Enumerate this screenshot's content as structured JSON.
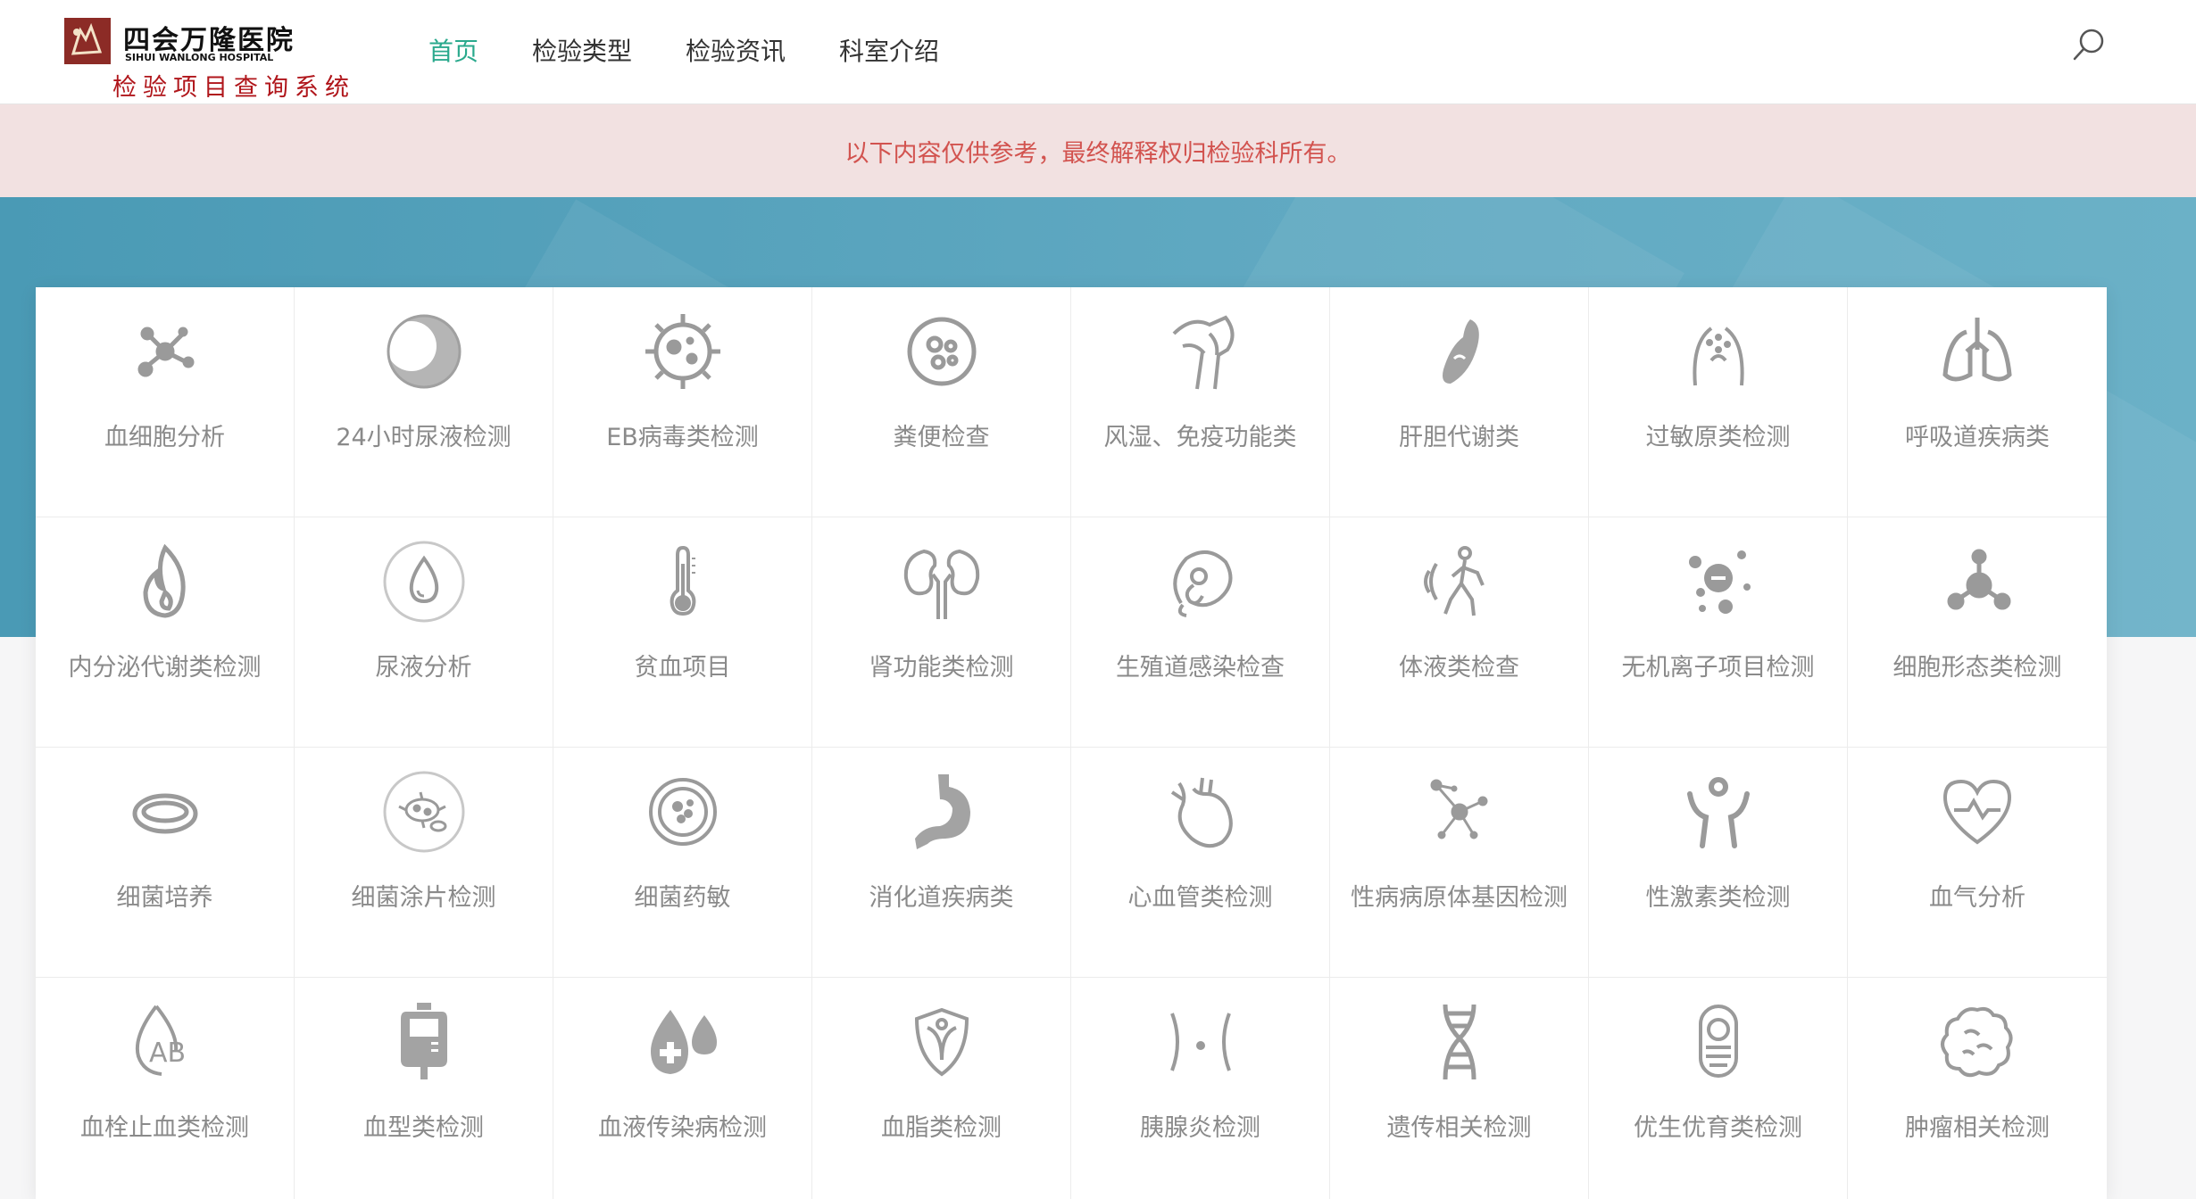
{
  "header": {
    "logo_cn": "四会万隆医院",
    "logo_en": "SIHUI WANLONG HOSPITAL",
    "system_name": "检验项目查询系统",
    "nav": [
      {
        "label": "首页",
        "active": true
      },
      {
        "label": "检验类型",
        "active": false
      },
      {
        "label": "检验资讯",
        "active": false
      },
      {
        "label": "科室介绍",
        "active": false
      }
    ],
    "search_icon": "search-icon"
  },
  "notice": {
    "text": "以下内容仅供参考，最终解释权归检验科所有。"
  },
  "colors": {
    "accent": "#2aa98d",
    "notice_bg": "#f2e1e1",
    "notice_text": "#d2534f",
    "banner": "#5fa8c1",
    "icon": "#9a9a9a",
    "brand_red": "#b0161b"
  },
  "categories": [
    {
      "label": "血细胞分析",
      "icon": "molecule-icon"
    },
    {
      "label": "24小时尿液检测",
      "icon": "moon-icon"
    },
    {
      "label": "EB病毒类检测",
      "icon": "virus-icon"
    },
    {
      "label": "粪便检查",
      "icon": "cell-icon"
    },
    {
      "label": "风湿、免疫功能类",
      "icon": "joint-icon"
    },
    {
      "label": "肝胆代谢类",
      "icon": "liver-icon"
    },
    {
      "label": "过敏原类检测",
      "icon": "allergy-icon"
    },
    {
      "label": "呼吸道疾病类",
      "icon": "lungs-icon"
    },
    {
      "label": "内分泌代谢类检测",
      "icon": "flame-icon"
    },
    {
      "label": "尿液分析",
      "icon": "droplet-icon"
    },
    {
      "label": "贫血项目",
      "icon": "thermometer-icon"
    },
    {
      "label": "肾功能类检测",
      "icon": "kidney-icon"
    },
    {
      "label": "生殖道感染检查",
      "icon": "embryo-icon"
    },
    {
      "label": "体液类检查",
      "icon": "body-fluid-icon"
    },
    {
      "label": "无机离子项目检测",
      "icon": "ion-icon"
    },
    {
      "label": "细胞形态类检测",
      "icon": "cell-morphology-icon"
    },
    {
      "label": "细菌培养",
      "icon": "petri-dish-icon"
    },
    {
      "label": "细菌涂片检测",
      "icon": "bacteria-icon"
    },
    {
      "label": "细菌药敏",
      "icon": "bacteria-culture-icon"
    },
    {
      "label": "消化道疾病类",
      "icon": "stomach-icon"
    },
    {
      "label": "心血管类检测",
      "icon": "heart-organ-icon"
    },
    {
      "label": "性病病原体基因检测",
      "icon": "network-icon"
    },
    {
      "label": "性激素类检测",
      "icon": "person-icon"
    },
    {
      "label": "血气分析",
      "icon": "heart-pulse-icon"
    },
    {
      "label": "血栓止血类检测",
      "icon": "blood-type-ab-icon"
    },
    {
      "label": "血型类检测",
      "icon": "blood-bag-icon"
    },
    {
      "label": "血液传染病检测",
      "icon": "blood-drop-plus-icon"
    },
    {
      "label": "血脂类检测",
      "icon": "shield-icon"
    },
    {
      "label": "胰腺炎检测",
      "icon": "pancreas-icon"
    },
    {
      "label": "遗传相关检测",
      "icon": "dna-icon"
    },
    {
      "label": "优生优育类检测",
      "icon": "baby-icon"
    },
    {
      "label": "肿瘤相关检测",
      "icon": "tumor-icon"
    }
  ]
}
